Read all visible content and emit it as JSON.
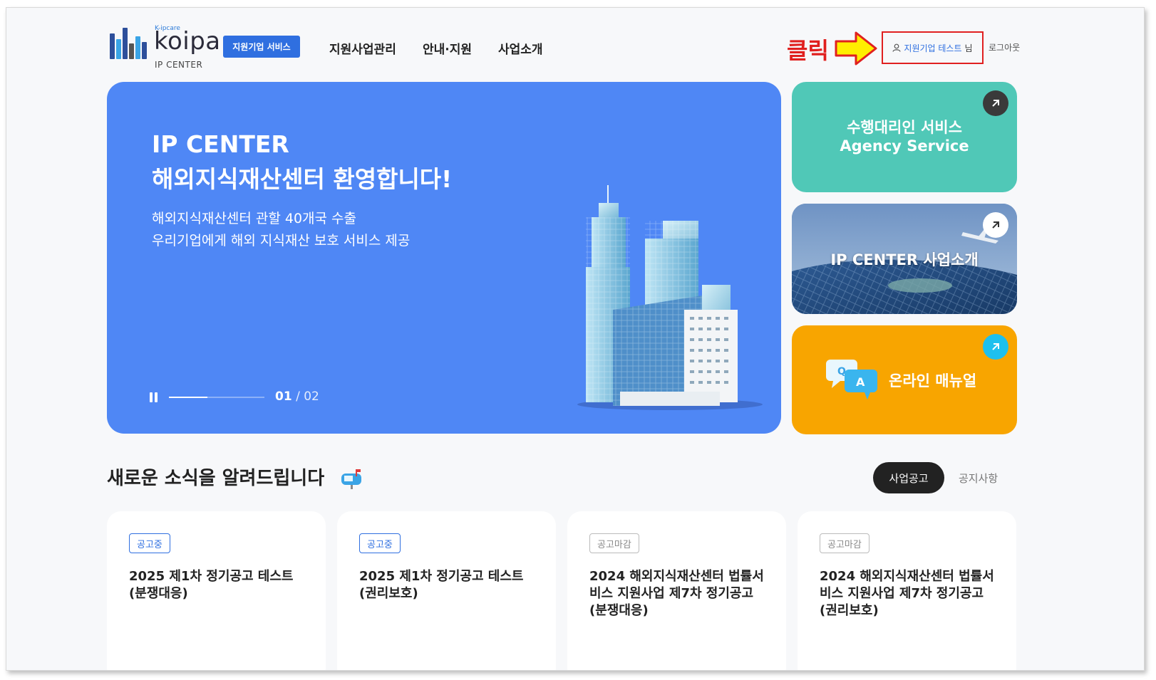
{
  "header": {
    "logo": {
      "small": "K-ipcare",
      "main": "koipa",
      "sub": "IP CENTER"
    },
    "service_badge": "지원기업 서비스",
    "nav": [
      "지원사업관리",
      "안내·지원",
      "사업소개"
    ],
    "annotation": "클릭",
    "user": {
      "name": "지원기업 테스트",
      "suffix": "님"
    },
    "logout": "로그아웃"
  },
  "hero": {
    "title_line1": "IP CENTER",
    "title_line2": "해외지식재산센터 환영합니다!",
    "subtitle_line1": "해외지식재산센터 관할 40개국 수출",
    "subtitle_line2": "우리기업에게 해외 지식재산 보호 서비스 제공",
    "current_slide": "01",
    "total_slides": "02",
    "progress": 0.4
  },
  "quick_cards": {
    "agency": {
      "line1": "수행대리인 서비스",
      "line2": "Agency Service"
    },
    "ipcenter": {
      "line1": "IP CENTER 사업소개"
    },
    "manual": {
      "line1": "온라인 매뉴얼"
    }
  },
  "news": {
    "title": "새로운 소식을 알려드립니다",
    "tabs": [
      "사업공고",
      "공지사항"
    ],
    "cards": [
      {
        "status": "공고중",
        "title": "2025 제1차 정기공고 테스트 (분쟁대응)"
      },
      {
        "status": "공고중",
        "title": "2025 제1차 정기공고 테스트 (권리보호)"
      },
      {
        "status": "공고마감",
        "title": "2024 해외지식재산센터 법률서비스 지원사업 제7차 정기공고 (분쟁대응)"
      },
      {
        "status": "공고마감",
        "title": "2024 해외지식재산센터 법률서비스 지원사업 제7차 정기공고 (권리보호)"
      }
    ]
  },
  "colors": {
    "primary": "#2f6fe0",
    "hero_bg": "#4f87f5",
    "agency": "#50c8b7",
    "manual": "#f8a500",
    "annotation_red": "#e0201f",
    "annotation_yellow": "#ffef00"
  }
}
